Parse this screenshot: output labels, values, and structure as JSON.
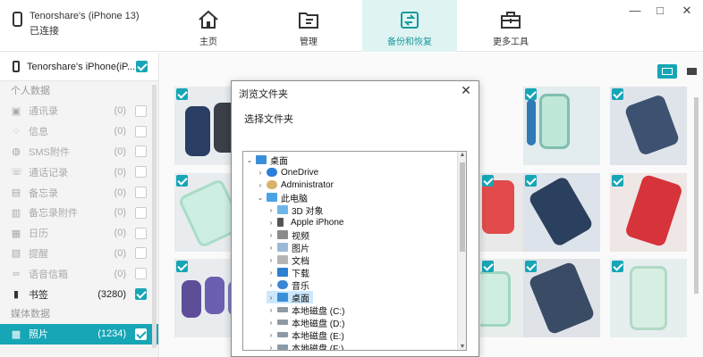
{
  "device": {
    "name_line": "Tenorshare's (iPhone 13)",
    "status": "已连接"
  },
  "nav": [
    {
      "label": "主页",
      "icon": "home-icon"
    },
    {
      "label": "管理",
      "icon": "folder-icon"
    },
    {
      "label": "备份和恢复",
      "icon": "backup-icon"
    },
    {
      "label": "更多工具",
      "icon": "toolbox-icon"
    }
  ],
  "window": {
    "minimize": "—",
    "maximize": "□",
    "close": "✕"
  },
  "sidebar": {
    "device_row": "Tenorshare's iPhone(iP...",
    "section_personal": "个人数据",
    "items": [
      {
        "label": "通讯录",
        "count": "(0)",
        "icon": "contacts-icon"
      },
      {
        "label": "信息",
        "count": "(0)",
        "icon": "message-icon"
      },
      {
        "label": "SMS附件",
        "count": "(0)",
        "icon": "sms-attachment-icon"
      },
      {
        "label": "通话记录",
        "count": "(0)",
        "icon": "call-log-icon"
      },
      {
        "label": "备忘录",
        "count": "(0)",
        "icon": "notes-icon"
      },
      {
        "label": "备忘录附件",
        "count": "(0)",
        "icon": "notes-attachment-icon"
      },
      {
        "label": "日历",
        "count": "(0)",
        "icon": "calendar-icon"
      },
      {
        "label": "提醒",
        "count": "(0)",
        "icon": "reminder-icon"
      },
      {
        "label": "语音信箱",
        "count": "(0)",
        "icon": "voicemail-icon"
      },
      {
        "label": "书签",
        "count": "(3280)",
        "icon": "bookmark-icon"
      }
    ],
    "section_media": "媒体数据",
    "photos": {
      "label": "照片",
      "count": "(1234)",
      "icon": "photo-icon"
    }
  },
  "dialog": {
    "title": "浏览文件夹",
    "close": "✕",
    "prompt": "选择文件夹",
    "tree": [
      {
        "label": "桌面",
        "icon": "desktop-folder-icon"
      },
      {
        "label": "OneDrive",
        "icon": "onedrive-icon"
      },
      {
        "label": "Administrator",
        "icon": "user-icon"
      },
      {
        "label": "此电脑",
        "icon": "computer-icon"
      },
      {
        "label": "3D 对象",
        "icon": "3d-objects-icon"
      },
      {
        "label": "Apple iPhone",
        "icon": "iphone-icon"
      },
      {
        "label": "视频",
        "icon": "video-folder-icon"
      },
      {
        "label": "图片",
        "icon": "pictures-folder-icon"
      },
      {
        "label": "文档",
        "icon": "documents-folder-icon"
      },
      {
        "label": "下载",
        "icon": "downloads-icon"
      },
      {
        "label": "音乐",
        "icon": "music-icon"
      },
      {
        "label": "桌面",
        "icon": "desktop-folder-icon"
      },
      {
        "label": "本地磁盘 (C:)",
        "icon": "drive-icon"
      },
      {
        "label": "本地磁盘 (D:)",
        "icon": "drive-icon"
      },
      {
        "label": "本地磁盘 (E:)",
        "icon": "drive-icon"
      },
      {
        "label": "本地磁盘 (F:)",
        "icon": "drive-icon"
      }
    ]
  },
  "colors": {
    "accent": "#16a6b6",
    "nav_active_bg": "#dff3f3"
  }
}
